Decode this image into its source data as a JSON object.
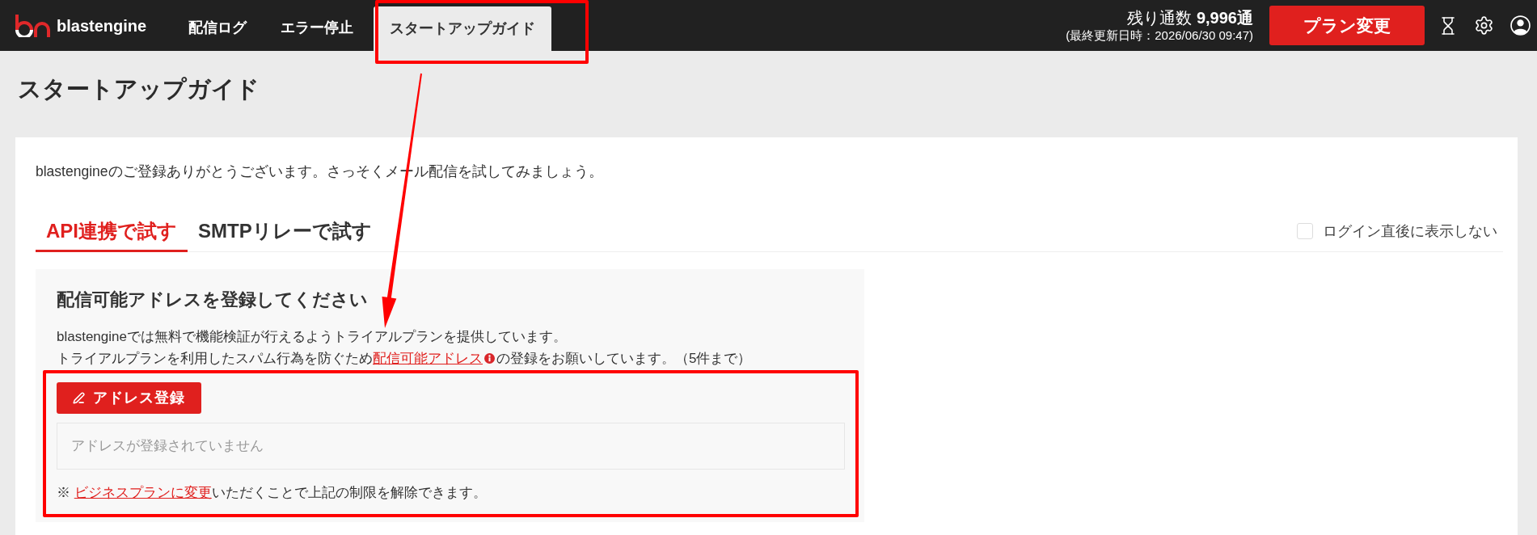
{
  "header": {
    "logo_text": "blastengine",
    "nav": [
      {
        "label": "配信ログ",
        "selected": false
      },
      {
        "label": "エラー停止",
        "selected": false
      },
      {
        "label": "スタートアップガイド",
        "selected": true
      }
    ],
    "remaining": "残り通数 **9,996通**",
    "updated": "(最終更新日時：2026/06/30 09:47)",
    "plan_button": "プラン変更"
  },
  "page_title": "スタートアップガイド",
  "intro": "blastengineのご登録ありがとうございます。さっそくメール配信を試してみましょう。",
  "tabs": [
    {
      "label": "API連携で試す",
      "selected": true
    },
    {
      "label": "SMTPリレーで試す",
      "selected": false
    }
  ],
  "hide_after_login": {
    "label": "ログイン直後に表示しない",
    "checked": false
  },
  "section": {
    "heading": "配信可能アドレスを登録してください",
    "line_1": "blastengineでは無料で機能検証が行えるようトライアルプランを提供しています。",
    "line_2": {
      "before": "トライアルプランを利用したスパム行為を防ぐため",
      "link": "配信可能アドレス",
      "after": "の登録をお願いしています。（5件まで）"
    },
    "register_button": "アドレス登録",
    "empty_message": "アドレスが登録されていません",
    "note": {
      "mark": "※",
      "link": "ビジネスプランに変更",
      "after": "いただくことで上記の制限を解除できます。"
    }
  }
}
